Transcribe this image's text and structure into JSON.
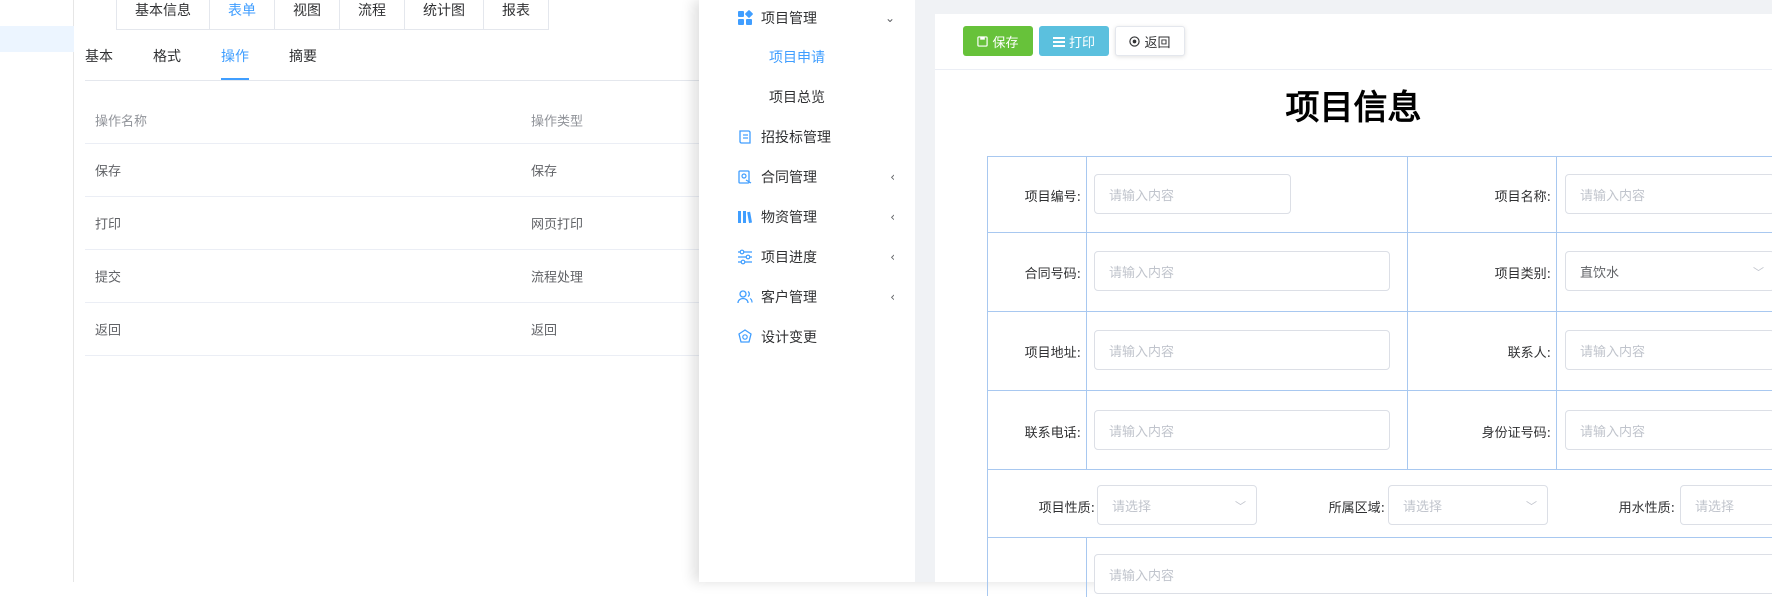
{
  "designer": {
    "top_tabs": [
      "基本信息",
      "表单",
      "视图",
      "流程",
      "统计图",
      "报表"
    ],
    "sub_tabs": [
      "基本",
      "格式",
      "操作",
      "摘要"
    ],
    "table_headers": [
      "操作名称",
      "操作类型"
    ],
    "rows": [
      [
        "保存",
        "保存"
      ],
      [
        "打印",
        "网页打印"
      ],
      [
        "提交",
        "流程处理"
      ],
      [
        "返回",
        "返回"
      ]
    ]
  },
  "menu": {
    "items": [
      {
        "label": "项目管理",
        "icon": "grid-icon",
        "arrow": "⌄"
      },
      {
        "label": "项目申请",
        "sub": true,
        "active": true
      },
      {
        "label": "项目总览",
        "sub": true
      },
      {
        "label": "招投标管理",
        "icon": "document-icon"
      },
      {
        "label": "合同管理",
        "icon": "contract-icon",
        "arrow": "‹"
      },
      {
        "label": "物资管理",
        "icon": "books-icon",
        "arrow": "‹"
      },
      {
        "label": "项目进度",
        "icon": "sliders-icon",
        "arrow": "‹"
      },
      {
        "label": "客户管理",
        "icon": "users-icon",
        "arrow": "‹"
      },
      {
        "label": "设计变更",
        "icon": "settings-icon"
      }
    ]
  },
  "toolbar": {
    "save_label": "保存",
    "print_label": "打印",
    "back_label": "返回"
  },
  "form": {
    "title": "项目信息",
    "placeholder": "请输入内容",
    "select_placeholder": "请选择",
    "labels": {
      "project_no": "项目编号:",
      "project_name": "项目名称:",
      "contract_no": "合同号码:",
      "project_type": "项目类别:",
      "address": "项目地址:",
      "contact": "联系人:",
      "phone": "联系电话:",
      "id_no": "身份证号码:",
      "nature": "项目性质:",
      "region": "所属区域:",
      "water_nature": "用水性质:"
    },
    "project_type_value": "直饮水"
  },
  "colors": {
    "accent": "#409eff",
    "save": "#67c23a",
    "print": "#5bc0de",
    "grid": "#a8c8f0"
  }
}
